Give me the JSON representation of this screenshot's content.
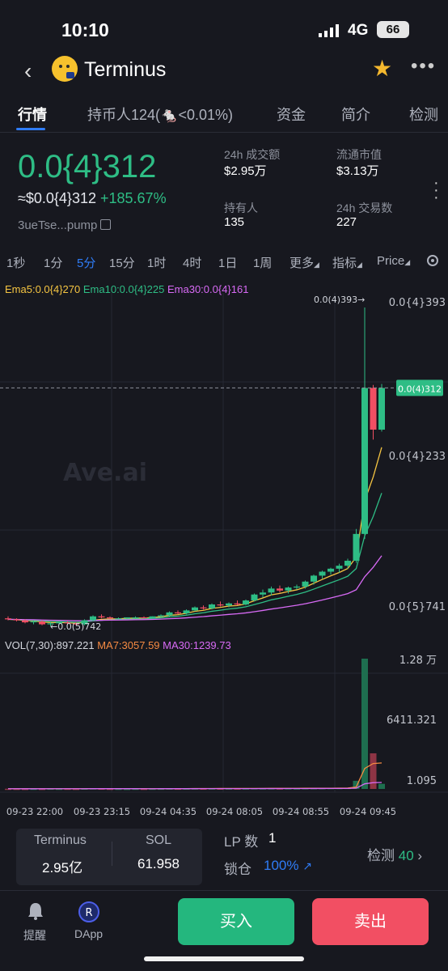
{
  "status": {
    "time": "10:10",
    "network": "4G",
    "battery": "66"
  },
  "header": {
    "token_name": "Terminus",
    "back_icon": "chevron-left-icon",
    "star_icon": "star-icon",
    "more_icon": "more-horizontal-icon"
  },
  "tabs": [
    {
      "label": "行情"
    },
    {
      "label": "持币人124("
    },
    {
      "label": "<0.01%)"
    },
    {
      "label": "资金"
    },
    {
      "label": "简介"
    },
    {
      "label": "检测"
    }
  ],
  "price": {
    "main": "0.0{4}312",
    "usd": "≈$0.0{4}312",
    "change": "+185.67%",
    "address": "3ueTse...pump"
  },
  "stats": {
    "vol_label": "24h 成交额",
    "vol_value": "$2.95万",
    "mcap_label": "流通市值",
    "mcap_value": "$3.13万",
    "holders_label": "持有人",
    "holders_value": "135",
    "txns_label": "24h 交易数",
    "txns_value": "227"
  },
  "intervals": [
    "1秒",
    "1分",
    "5分",
    "15分",
    "1时",
    "4时",
    "1日",
    "1周",
    "更多",
    "指标",
    "Price"
  ],
  "ema": {
    "ema5": "Ema5:0.0{4}270",
    "ema10": "Ema10:0.0{4}225",
    "ema30": "Ema30:0.0{4}161"
  },
  "vol": {
    "vol": "VOL(7,30):897.221",
    "ma7": "MA7:3057.59",
    "ma30": "MA30:1239.73"
  },
  "chart_data": {
    "type": "candlestick",
    "watermark": "Ave.ai",
    "price_axis": [
      "0.0{4}393",
      "0.0{4}233",
      "0.0{5}741"
    ],
    "current_price_tag": "0.0(4)312",
    "high_marker": "0.0(4)393→",
    "low_marker": "←0.0(5)742",
    "volume_axis": [
      "1.28 万",
      "6411.321",
      "1.095"
    ],
    "time_axis": [
      "09-23 22:00",
      "09-23 23:15",
      "09-24 04:35",
      "09-24 08:05",
      "09-24 08:55",
      "09-24 09:45"
    ],
    "candles": [
      [
        0.8,
        0.82,
        0.78,
        0.79
      ],
      [
        0.79,
        0.8,
        0.77,
        0.78
      ],
      [
        0.78,
        0.79,
        0.75,
        0.76
      ],
      [
        0.76,
        0.78,
        0.74,
        0.77
      ],
      [
        0.77,
        0.78,
        0.73,
        0.74
      ],
      [
        0.74,
        0.76,
        0.72,
        0.75
      ],
      [
        0.75,
        0.77,
        0.74,
        0.76
      ],
      [
        0.76,
        0.77,
        0.74,
        0.75
      ],
      [
        0.75,
        0.76,
        0.73,
        0.74
      ],
      [
        0.74,
        0.79,
        0.73,
        0.78
      ],
      [
        0.78,
        0.83,
        0.77,
        0.82
      ],
      [
        0.82,
        0.84,
        0.8,
        0.81
      ],
      [
        0.81,
        0.82,
        0.79,
        0.8
      ],
      [
        0.8,
        0.81,
        0.79,
        0.8
      ],
      [
        0.8,
        0.81,
        0.79,
        0.81
      ],
      [
        0.81,
        0.82,
        0.8,
        0.81
      ],
      [
        0.81,
        0.82,
        0.8,
        0.8
      ],
      [
        0.8,
        0.82,
        0.8,
        0.82
      ],
      [
        0.82,
        0.84,
        0.81,
        0.83
      ],
      [
        0.83,
        0.87,
        0.82,
        0.86
      ],
      [
        0.86,
        0.88,
        0.84,
        0.85
      ],
      [
        0.85,
        0.89,
        0.84,
        0.88
      ],
      [
        0.88,
        0.92,
        0.87,
        0.91
      ],
      [
        0.91,
        0.93,
        0.89,
        0.9
      ],
      [
        0.9,
        0.95,
        0.89,
        0.94
      ],
      [
        0.94,
        0.97,
        0.92,
        0.93
      ],
      [
        0.93,
        0.96,
        0.91,
        0.95
      ],
      [
        0.95,
        0.98,
        0.93,
        0.94
      ],
      [
        0.94,
        0.99,
        0.93,
        0.98
      ],
      [
        0.98,
        1.05,
        0.97,
        1.04
      ],
      [
        1.04,
        1.09,
        1.01,
        1.06
      ],
      [
        1.06,
        1.12,
        1.03,
        1.1
      ],
      [
        1.1,
        1.13,
        1.06,
        1.08
      ],
      [
        1.08,
        1.12,
        1.05,
        1.11
      ],
      [
        1.11,
        1.14,
        1.09,
        1.12
      ],
      [
        1.12,
        1.18,
        1.1,
        1.17
      ],
      [
        1.17,
        1.24,
        1.14,
        1.23
      ],
      [
        1.23,
        1.28,
        1.2,
        1.27
      ],
      [
        1.27,
        1.31,
        1.24,
        1.3
      ],
      [
        1.3,
        1.35,
        1.26,
        1.33
      ],
      [
        1.33,
        1.4,
        1.3,
        1.38
      ],
      [
        1.38,
        1.7,
        1.36,
        1.65
      ],
      [
        1.65,
        3.93,
        1.6,
        3.12
      ],
      [
        3.12,
        3.15,
        2.6,
        2.7
      ],
      [
        2.7,
        3.16,
        2.68,
        3.12
      ]
    ],
    "volumes": [
      20,
      15,
      10,
      18,
      12,
      30,
      20,
      25,
      15,
      40,
      60,
      35,
      20,
      15,
      10,
      22,
      18,
      25,
      30,
      45,
      35,
      40,
      55,
      38,
      50,
      42,
      48,
      44,
      52,
      70,
      60,
      65,
      58,
      62,
      55,
      75,
      80,
      85,
      90,
      95,
      110,
      800,
      12800,
      3500,
      500
    ],
    "volume_up": [
      false,
      false,
      false,
      true,
      false,
      true,
      true,
      false,
      false,
      true,
      true,
      false,
      false,
      true,
      true,
      true,
      false,
      true,
      true,
      true,
      false,
      true,
      true,
      false,
      true,
      false,
      true,
      false,
      true,
      true,
      true,
      true,
      false,
      true,
      true,
      true,
      true,
      true,
      true,
      true,
      true,
      true,
      true,
      false,
      true
    ]
  },
  "footer": {
    "token_label": "Terminus",
    "token_amount": "2.95亿",
    "sol_label": "SOL",
    "sol_amount": "61.958",
    "lp_label": "LP 数",
    "lp_value": "1",
    "lock_label": "锁仓",
    "lock_value": "100%",
    "check_label": "检测",
    "check_value": "40"
  },
  "bottom": {
    "alert_label": "提醒",
    "dapp_label": "DApp",
    "buy_label": "买入",
    "sell_label": "卖出"
  },
  "colors": {
    "up": "#2ebd85",
    "down": "#f24f63",
    "accent": "#2f7cf6",
    "bg": "#17181f"
  }
}
